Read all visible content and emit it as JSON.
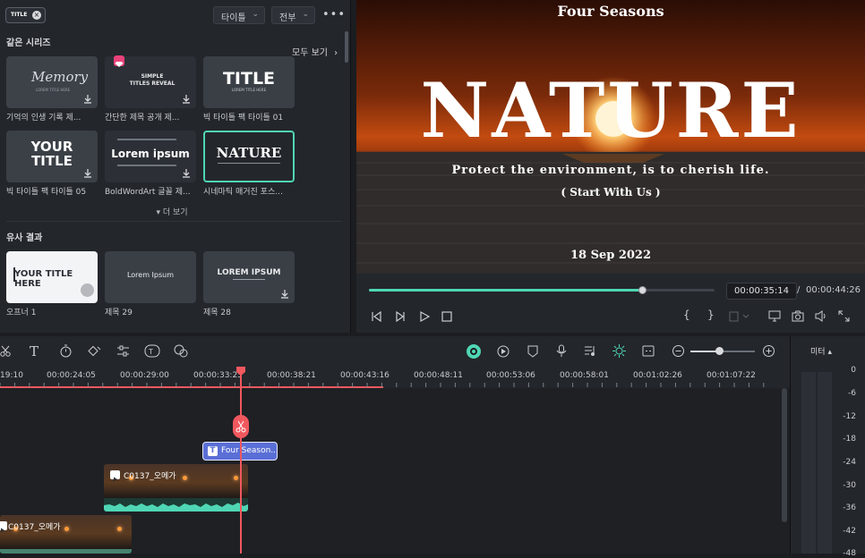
{
  "browser": {
    "filter_tag": "TITLE",
    "dropdown_titles": "타이틀",
    "dropdown_all": "전부",
    "more": "•••",
    "same_series_heading": "같은 시리즈",
    "see_all": "모두 보기",
    "see_all_chevron": "›",
    "show_more": "▾ 더 보기",
    "similar_heading": "유사 결과",
    "series_items": [
      {
        "caption": "기억의 인생 기록 제...",
        "thumb_text": "Memory",
        "thumb_sub": "LOREM TITLE HERE"
      },
      {
        "caption": "간단한 제목 공개 제...",
        "thumb_text": "SIMPLE\nTITLES REVEAL",
        "thumb_sub": ""
      },
      {
        "caption": "빅 타이틀 팩 타이틀 01",
        "thumb_text": "TITLE",
        "thumb_sub": "LOREM TITLE HERE"
      },
      {
        "caption": "빅 타이틀 팩 타이틀 05",
        "thumb_text": "YOUR\nTITLE",
        "thumb_sub": ""
      },
      {
        "caption": "BoldWordArt 글꼴 제...",
        "thumb_text": "Lorem ipsum",
        "thumb_sub": ""
      },
      {
        "caption": "시네마틱 매거진 포스...",
        "thumb_text": "NATURE",
        "thumb_sub": ""
      }
    ],
    "similar_items": [
      {
        "caption": "오프너 1",
        "thumb_text": "YOUR TITLE HERE"
      },
      {
        "caption": "제목 29",
        "thumb_text": "Lorem Ipsum"
      },
      {
        "caption": "제목 28",
        "thumb_text": "LOREM IPSUM"
      }
    ]
  },
  "preview": {
    "top_text": "Four Seasons",
    "main_title": "NATURE",
    "tagline": "Protect the environment, is to cherish life.",
    "sub_tagline": "( Start With Us )",
    "date": "18 Sep 2022",
    "current_time": "00:00:35:14",
    "time_separator": "/",
    "total_time": "00:00:44:26",
    "progress_fraction": 0.79
  },
  "timeline": {
    "ruler_labels": [
      "19:10",
      "00:00:24:05",
      "00:00:29:00",
      "00:00:33:25",
      "00:00:38:21",
      "00:00:43:16",
      "00:00:48:11",
      "00:00:53:06",
      "00:00:58:01",
      "00:01:02:26",
      "00:01:07:22"
    ],
    "title_clip": "Four Season...",
    "clip1": "C0137_오메가",
    "clip2": "C0137_오메가",
    "zoom_fraction": 0.45
  },
  "meter": {
    "label": "미터",
    "label_chevron": "▴",
    "scale": [
      "0",
      "-6",
      "-12",
      "-18",
      "-24",
      "-30",
      "-36",
      "-42",
      "-48"
    ]
  },
  "colors": {
    "accent": "#4fd6b4",
    "playhead": "#f0585e",
    "title_clip": "#5a6fd6"
  }
}
